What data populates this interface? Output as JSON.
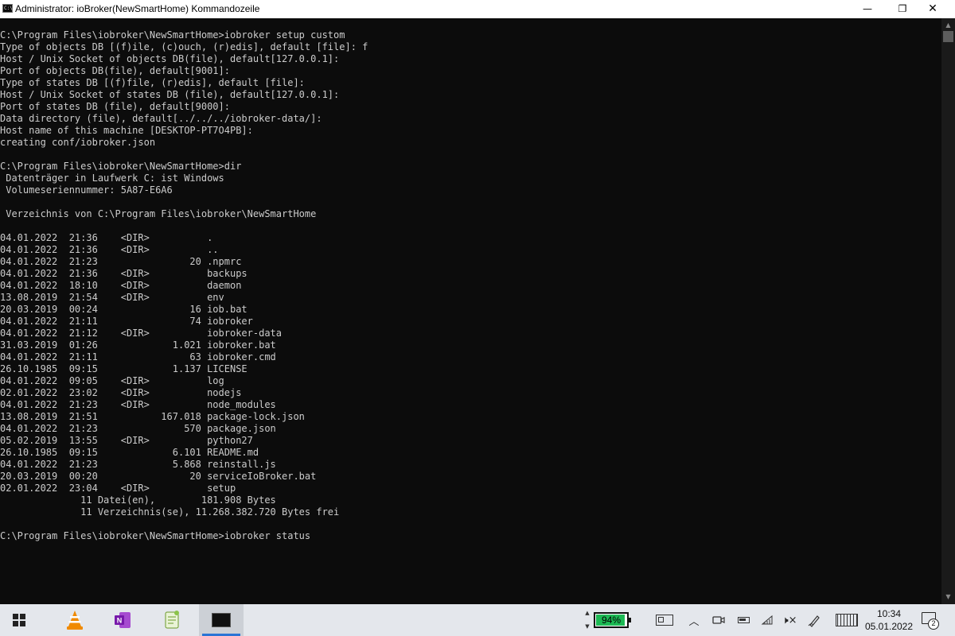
{
  "window": {
    "title": "Administrator: ioBroker(NewSmartHome) Kommandozeile",
    "icon": "cmd-icon",
    "controls": {
      "minimize": "—",
      "restore": "❐",
      "close": "✕"
    }
  },
  "console": {
    "lines": [
      "C:\\Program Files\\iobroker\\NewSmartHome>iobroker setup custom",
      "Type of objects DB [(f)ile, (c)ouch, (r)edis], default [file]: f",
      "Host / Unix Socket of objects DB(file), default[127.0.0.1]:",
      "Port of objects DB(file), default[9001]:",
      "Type of states DB [(f)file, (r)edis], default [file]:",
      "Host / Unix Socket of states DB (file), default[127.0.0.1]:",
      "Port of states DB (file), default[9000]:",
      "Data directory (file), default[../../../iobroker-data/]:",
      "Host name of this machine [DESKTOP-PT7O4PB]:",
      "creating conf/iobroker.json",
      "",
      "C:\\Program Files\\iobroker\\NewSmartHome>dir",
      " Datenträger in Laufwerk C: ist Windows",
      " Volumeseriennummer: 5A87-E6A6",
      "",
      " Verzeichnis von C:\\Program Files\\iobroker\\NewSmartHome",
      "",
      "04.01.2022  21:36    <DIR>          .",
      "04.01.2022  21:36    <DIR>          ..",
      "04.01.2022  21:23                20 .npmrc",
      "04.01.2022  21:36    <DIR>          backups",
      "04.01.2022  18:10    <DIR>          daemon",
      "13.08.2019  21:54    <DIR>          env",
      "20.03.2019  00:24                16 iob.bat",
      "04.01.2022  21:11                74 iobroker",
      "04.01.2022  21:12    <DIR>          iobroker-data",
      "31.03.2019  01:26             1.021 iobroker.bat",
      "04.01.2022  21:11                63 iobroker.cmd",
      "26.10.1985  09:15             1.137 LICENSE",
      "04.01.2022  09:05    <DIR>          log",
      "02.01.2022  23:02    <DIR>          nodejs",
      "04.01.2022  21:23    <DIR>          node_modules",
      "13.08.2019  21:51           167.018 package-lock.json",
      "04.01.2022  21:23               570 package.json",
      "05.02.2019  13:55    <DIR>          python27",
      "26.10.1985  09:15             6.101 README.md",
      "04.01.2022  21:23             5.868 reinstall.js",
      "20.03.2019  00:20                20 serviceIoBroker.bat",
      "02.01.2022  23:04    <DIR>          setup",
      "              11 Datei(en),        181.908 Bytes",
      "              11 Verzeichnis(se), 11.268.382.720 Bytes frei",
      "",
      "C:\\Program Files\\iobroker\\NewSmartHome>iobroker status"
    ]
  },
  "taskbar": {
    "battery_percent_label": "94%",
    "battery_level": 0.94,
    "clock": {
      "time": "10:34",
      "date": "05.01.2022"
    },
    "notification_count": "2",
    "apps": [
      "windows-start-icon",
      "vlc-icon",
      "onenote-icon",
      "notepad-plus-plus-icon",
      "command-prompt-icon"
    ]
  },
  "colors": {
    "console_bg": "#0c0c0c",
    "console_text": "#cccccc",
    "battery_fill": "#1db954",
    "taskbar_bg": "#e4e7ec"
  }
}
